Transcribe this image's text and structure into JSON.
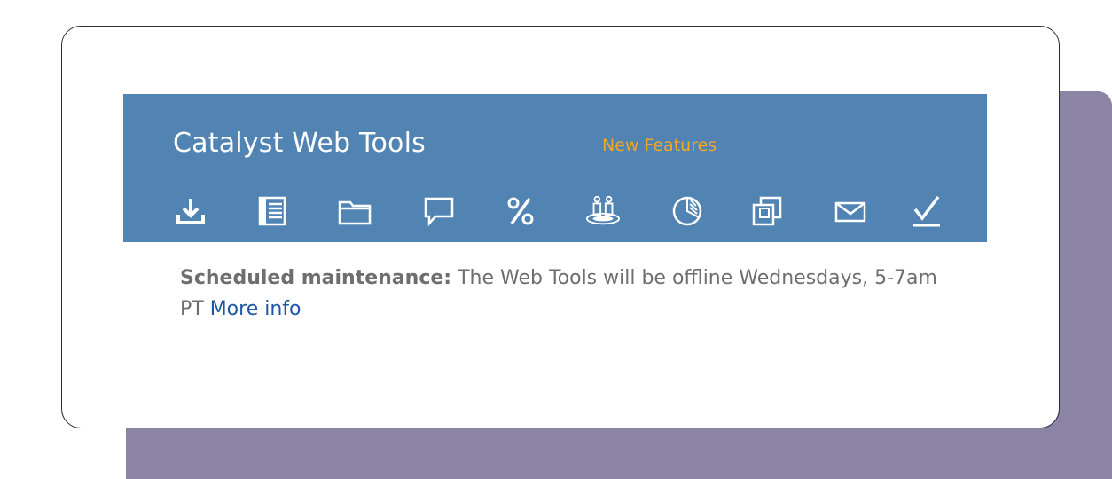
{
  "header": {
    "title": "Catalyst Web Tools",
    "new_features": "New Features"
  },
  "toolbar": {
    "icons": [
      "download-icon",
      "list-icon",
      "folder-icon",
      "chat-icon",
      "percent-icon",
      "people-icon",
      "chart-icon",
      "copy-icon",
      "mail-icon",
      "checkmark-icon"
    ]
  },
  "notice": {
    "label": "Scheduled maintenance:",
    "text": " The Web Tools will be offline Wednesdays, 5-7am PT ",
    "link": "More info"
  },
  "colors": {
    "header_bg": "#5183b3",
    "accent_orange": "#f0a825",
    "link_blue": "#1d55a8",
    "panel_purple": "#8c84a4"
  }
}
